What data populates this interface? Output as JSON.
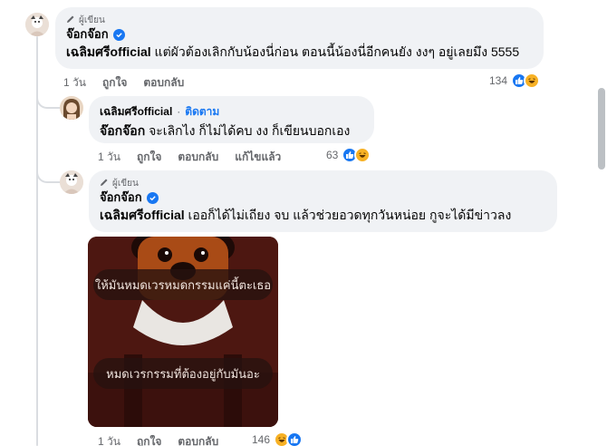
{
  "comments": [
    {
      "author_badge": "ผู้เขียน",
      "author": "จ๊อกจ๊อก",
      "mention": "เฉลิมศรีofficial",
      "text": " แต่ผัวต้องเลิกกับน้องนี่ก่อน ตอนนี้น้องนี่อีกคนยัง งงๆ อยู่เลยมึง 5555",
      "time": "1 วัน",
      "like_label": "ถูกใจ",
      "reply_label": "ตอบกลับ",
      "reaction_count": "134"
    },
    {
      "author": "เฉลิมศรีofficial",
      "separator": "·",
      "follow_label": "ติดตาม",
      "mention": "จ๊อกจ๊อก",
      "text": " จะเลิกไง ก็ไม่ได้คบ งง ก็เขียนบอกเอง",
      "time": "1 วัน",
      "like_label": "ถูกใจ",
      "reply_label": "ตอบกลับ",
      "edited_label": "แก้ไขแล้ว",
      "reaction_count": "63"
    },
    {
      "author_badge": "ผู้เขียน",
      "author": "จ๊อกจ๊อก",
      "mention": "เฉลิมศรีofficial",
      "text": " เออก็ได้ไม่เถียง จบ แล้วช่วยอวดทุกวันหน่อย กูจะได้มีข่าวลง",
      "photo_caption_top": "ให้มันหมดเวรหมดกรรมแค่นี้ตะเธอ",
      "photo_caption_bottom": "หมดเวรกรรมที่ต้องอยู่กับมันอะ",
      "time": "1 วัน",
      "like_label": "ถูกใจ",
      "reply_label": "ตอบกลับ",
      "reaction_count": "146"
    }
  ],
  "icons": {
    "like": "thumbs-up-icon",
    "haha": "laughing-face-icon",
    "verified": "verified-check-icon",
    "author": "pencil-icon"
  },
  "colors": {
    "accent": "#1877f2",
    "bubble": "#f0f2f5",
    "muted": "#65676b",
    "haha": "#f7b125"
  }
}
